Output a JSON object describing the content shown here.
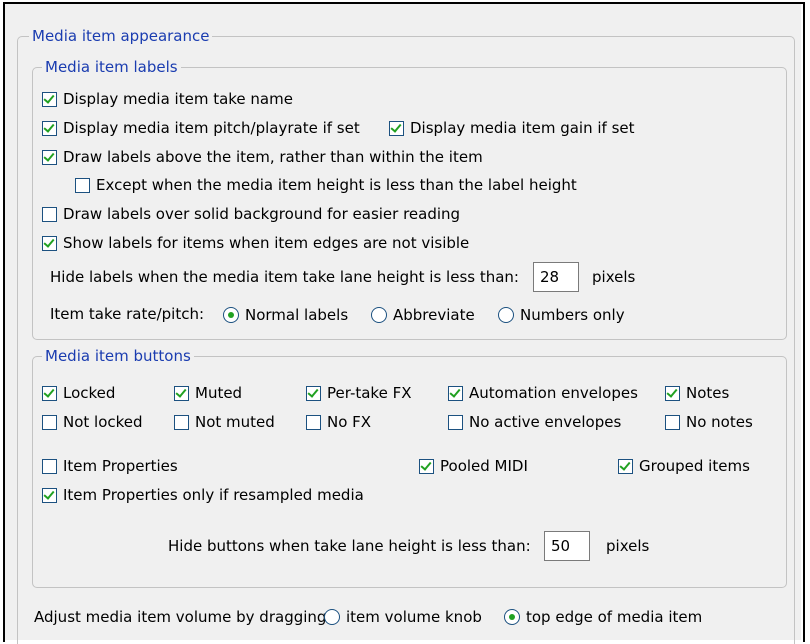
{
  "appearance": {
    "title": "Media item appearance",
    "labels_group": {
      "title": "Media item labels",
      "display_take_name": {
        "label": "Display media item take name",
        "checked": true
      },
      "display_pitch": {
        "label": "Display media item pitch/playrate if set",
        "checked": true
      },
      "display_gain": {
        "label": "Display media item gain if set",
        "checked": true
      },
      "draw_above": {
        "label": "Draw labels above the item, rather than within the item",
        "checked": true
      },
      "except_height": {
        "label": "Except when the media item height is less than the label height",
        "checked": false
      },
      "draw_solid_bg": {
        "label": "Draw labels over solid background for easier reading",
        "checked": false
      },
      "show_edges": {
        "label": "Show labels for items when item edges are not visible",
        "checked": true
      },
      "hide_labels_prefix": "Hide labels when the media item take lane height is less than:",
      "hide_labels_value": "28",
      "hide_labels_suffix": "pixels",
      "rate_pitch_label": "Item take rate/pitch:",
      "rate_options": [
        "Normal labels",
        "Abbreviate",
        "Numbers only"
      ],
      "rate_selected": "Normal labels"
    },
    "buttons_group": {
      "title": "Media item buttons",
      "row1": [
        "Locked",
        "Muted",
        "Per-take FX",
        "Automation envelopes",
        "Notes"
      ],
      "row2": [
        "Not locked",
        "Not muted",
        "No FX",
        "No active envelopes",
        "No notes"
      ],
      "item_properties": {
        "label": "Item Properties",
        "checked": false
      },
      "pooled_midi": {
        "label": "Pooled MIDI",
        "checked": true
      },
      "grouped_items": {
        "label": "Grouped items",
        "checked": true
      },
      "props_resampled": {
        "label": "Item Properties only if resampled media",
        "checked": true
      },
      "hide_buttons_prefix": "Hide buttons when take lane height is less than:",
      "hide_buttons_value": "50",
      "hide_buttons_suffix": "pixels"
    },
    "volume": {
      "label": "Adjust media item volume by dragging:",
      "options": [
        "item volume knob",
        "top edge of media item"
      ],
      "selected": "top edge of media item"
    }
  },
  "colors": {
    "accent_text": "#1a3cb0",
    "check_green": "#21a121"
  }
}
